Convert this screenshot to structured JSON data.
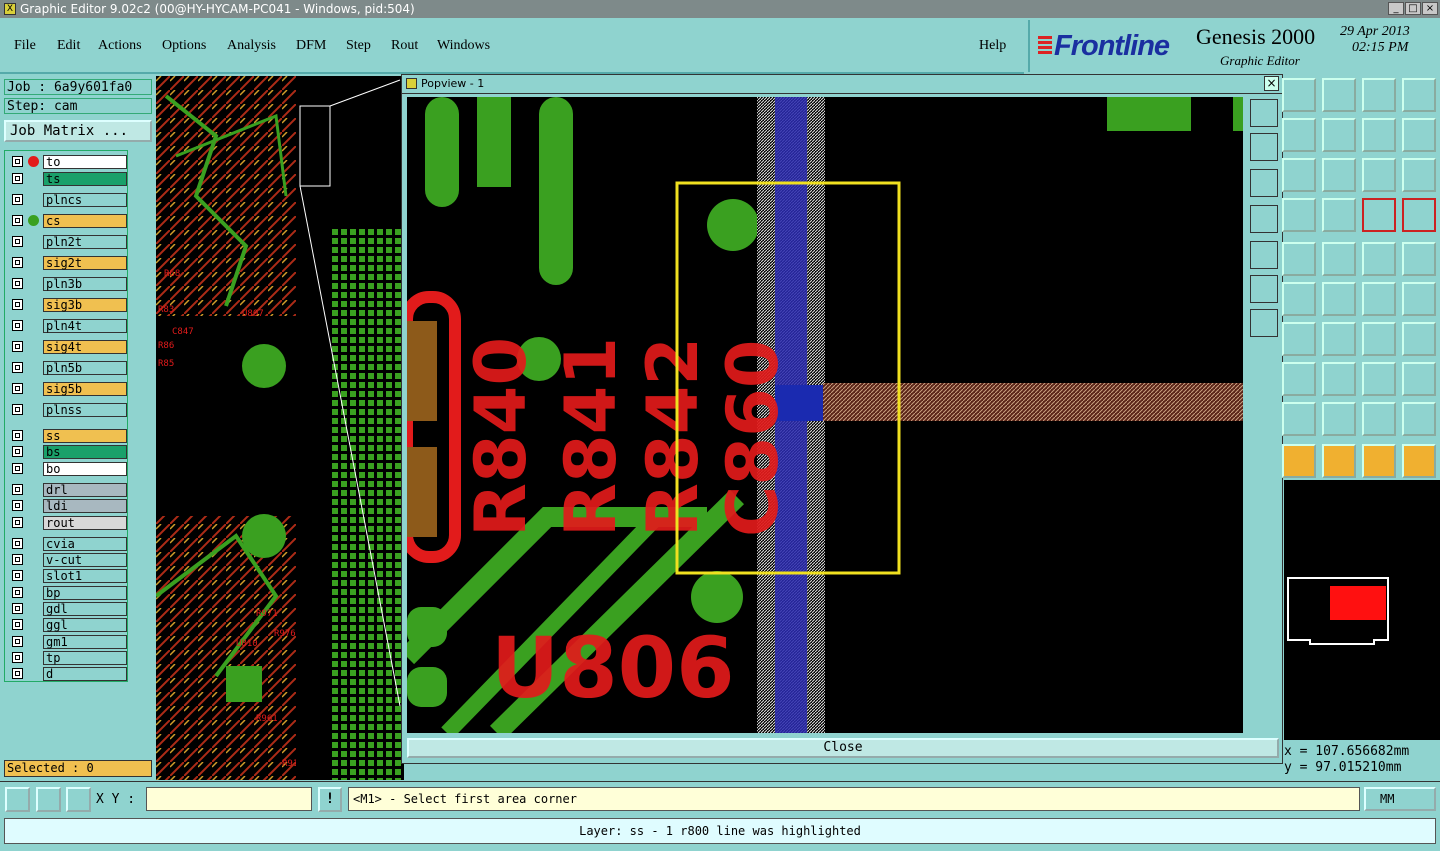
{
  "window": {
    "title": "Graphic Editor 9.02c2 (00@HY-HYCAM-PC041 - Windows, pid:504)"
  },
  "menu": {
    "file": "File",
    "edit": "Edit",
    "actions": "Actions",
    "options": "Options",
    "analysis": "Analysis",
    "dfm": "DFM",
    "step": "Step",
    "rout": "Rout",
    "windows": "Windows",
    "help": "Help"
  },
  "brand": {
    "logo": "Frontline",
    "product": "Genesis 2000",
    "subtitle": "Graphic Editor",
    "date": "29 Apr 2013",
    "time": "02:15 PM"
  },
  "job": {
    "job_label": "Job : 6a9y601fa0",
    "step_label": "Step: cam",
    "matrix_button": "Job Matrix ..."
  },
  "layers": [
    {
      "name": "to",
      "color": "#ffffff",
      "dot": "#e21b1b"
    },
    {
      "name": "ts",
      "color": "#1aa06a",
      "dot": ""
    },
    {
      "name": "plncs",
      "color": "#8fd3cf",
      "dot": ""
    },
    {
      "name": "cs",
      "color": "#f0c050",
      "dot": "#3aa020"
    },
    {
      "name": "pln2t",
      "color": "#8fd3cf",
      "dot": ""
    },
    {
      "name": "sig2t",
      "color": "#f0c050",
      "dot": ""
    },
    {
      "name": "pln3b",
      "color": "#8fd3cf",
      "dot": ""
    },
    {
      "name": "sig3b",
      "color": "#f0c050",
      "dot": ""
    },
    {
      "name": "pln4t",
      "color": "#8fd3cf",
      "dot": ""
    },
    {
      "name": "sig4t",
      "color": "#f0c050",
      "dot": ""
    },
    {
      "name": "pln5b",
      "color": "#8fd3cf",
      "dot": ""
    },
    {
      "name": "sig5b",
      "color": "#f0c050",
      "dot": ""
    },
    {
      "name": "plnss",
      "color": "#8fd3cf",
      "dot": ""
    },
    {
      "name": "ss",
      "color": "#f0c050",
      "dot": ""
    },
    {
      "name": "bs",
      "color": "#1aa06a",
      "dot": ""
    },
    {
      "name": "bo",
      "color": "#ffffff",
      "dot": ""
    },
    {
      "name": "drl",
      "color": "#a8b8c0",
      "dot": ""
    },
    {
      "name": "ldi",
      "color": "#a8b8c0",
      "dot": ""
    },
    {
      "name": "rout",
      "color": "#d8d8d8",
      "dot": ""
    },
    {
      "name": "cvia",
      "color": "#8fd3cf",
      "dot": ""
    },
    {
      "name": "v-cut",
      "color": "#8fd3cf",
      "dot": ""
    },
    {
      "name": "slot1",
      "color": "#8fd3cf",
      "dot": ""
    },
    {
      "name": "bp",
      "color": "#8fd3cf",
      "dot": ""
    },
    {
      "name": "gdl",
      "color": "#8fd3cf",
      "dot": ""
    },
    {
      "name": "ggl",
      "color": "#8fd3cf",
      "dot": ""
    },
    {
      "name": "gm1",
      "color": "#8fd3cf",
      "dot": ""
    },
    {
      "name": "tp",
      "color": "#8fd3cf",
      "dot": ""
    },
    {
      "name": "d",
      "color": "#8fd3cf",
      "dot": ""
    }
  ],
  "selected": "Selected : 0",
  "popview": {
    "title": "Popview - 1",
    "close_x": "×",
    "close_button": "Close",
    "refdes": [
      "R840",
      "R841",
      "R842",
      "C860"
    ],
    "component": "U806"
  },
  "pcb_left_labels": [
    "U807",
    "R83",
    "C847",
    "R86",
    "R85",
    "R971",
    "R961",
    "U810",
    "R976",
    "R913",
    "R68"
  ],
  "coords": {
    "x": "x = 107.656682mm",
    "y": "y = 97.015210mm"
  },
  "command": {
    "xy_label": "X Y :",
    "xy_value": "",
    "prompt": "<M1> - Select first area corner",
    "units": "MM",
    "warn": "!"
  },
  "status": "Layer: ss - 1 r800 line was highlighted",
  "colors": {
    "panel": "#8fd3cf",
    "copper": "#3aa020",
    "silk": "#e21b1b",
    "highlight": "#1a2ab0",
    "select_box": "#f0e020"
  }
}
